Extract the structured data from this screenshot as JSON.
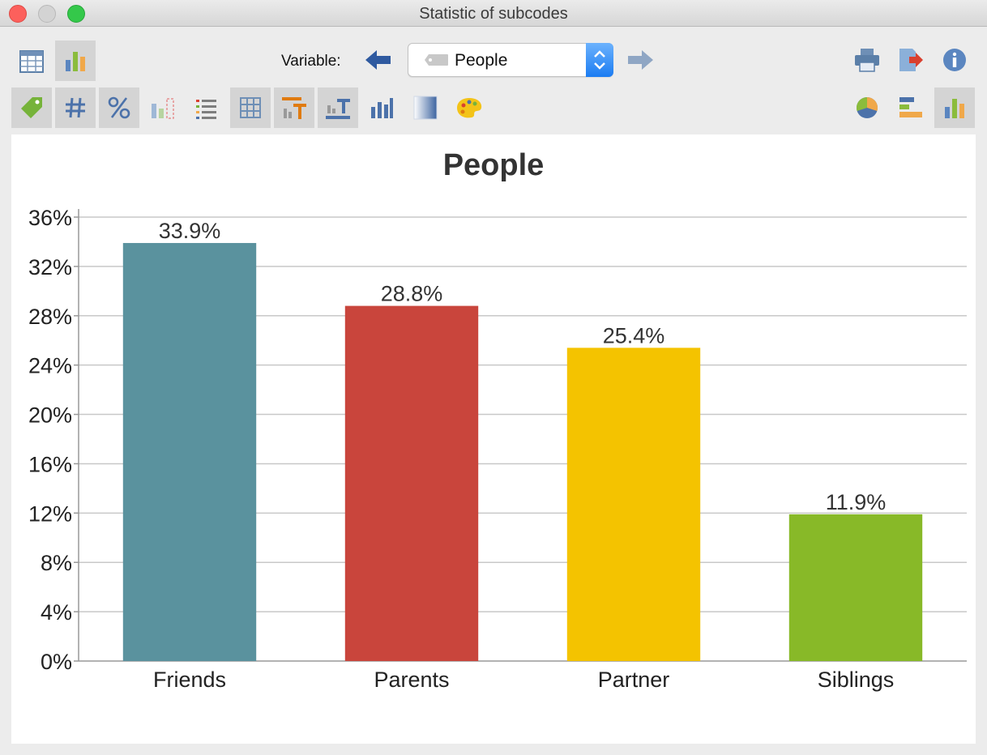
{
  "window": {
    "title": "Statistic of subcodes"
  },
  "toolbar": {
    "variable_label": "Variable:",
    "variable_value": "People",
    "left_icons": [
      "table-view-icon",
      "chart-view-icon"
    ],
    "right_icons": [
      "print-icon",
      "export-icon",
      "info-icon"
    ],
    "format_icons": [
      "tag-icon",
      "hash-icon",
      "percent-icon",
      "missing-values-icon",
      "list-icon",
      "grid-icon",
      "title-text-icon",
      "label-text-icon",
      "bar-chart-icon",
      "gradient-icon",
      "palette-icon"
    ],
    "chart_type_icons": [
      "pie-chart-icon",
      "horizontal-bar-icon",
      "vertical-bar-icon"
    ]
  },
  "colors": {
    "friends": "#5a929e",
    "parents": "#c9453c",
    "partner": "#f4c300",
    "siblings": "#88b928"
  },
  "chart_data": {
    "type": "bar",
    "title": "People",
    "categories": [
      "Friends",
      "Parents",
      "Partner",
      "Siblings"
    ],
    "values": [
      33.9,
      28.8,
      25.4,
      11.9
    ],
    "value_labels": [
      "33.9%",
      "28.8%",
      "25.4%",
      "11.9%"
    ],
    "bar_colors": [
      "#5a929e",
      "#c9453c",
      "#f4c300",
      "#88b928"
    ],
    "ylim": [
      0,
      36
    ],
    "yticks": [
      "0%",
      "4%",
      "8%",
      "12%",
      "16%",
      "20%",
      "24%",
      "28%",
      "32%",
      "36%"
    ],
    "grid": true,
    "xlabel": "",
    "ylabel": ""
  }
}
